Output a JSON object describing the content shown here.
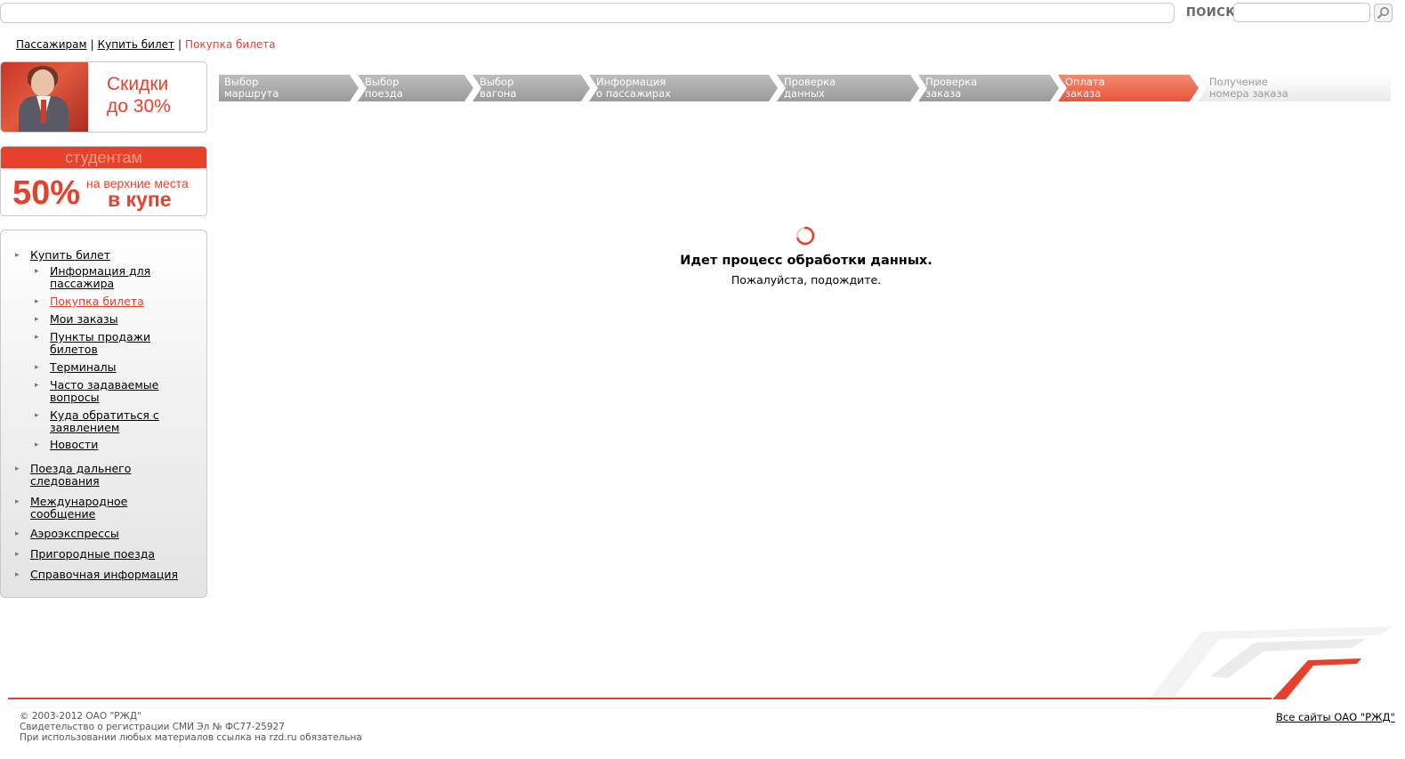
{
  "search": {
    "top_value": "",
    "label": "ПОИСК",
    "value": "",
    "button_icon": "magnifier-icon"
  },
  "breadcrumb": {
    "items": [
      "Пассажирам",
      "Купить билет"
    ],
    "separator": "|",
    "current": "Покупка билета"
  },
  "banners": {
    "discount": {
      "line1": "Скидки",
      "line2": "до 30%"
    },
    "students": {
      "header": "студентам",
      "percent": "50%",
      "line1": "на верхние места",
      "line2": "в купе"
    }
  },
  "sidemenu": {
    "top1": "Купить билет",
    "sub": [
      "Информация для пассажира",
      "Покупка билета",
      "Мои заказы",
      "Пункты продажи билетов",
      "Терминалы",
      "Часто задаваемые вопросы",
      "Куда обратиться с заявлением",
      "Новости"
    ],
    "top": [
      "Поезда дальнего следования",
      "Международное сообщение",
      "Аэроэкспрессы",
      "Пригородные поезда",
      "Справочная информация"
    ]
  },
  "steps": [
    {
      "l1": "Выбор",
      "l2": "маршрута",
      "state": "done"
    },
    {
      "l1": "Выбор",
      "l2": "поезда",
      "state": "done"
    },
    {
      "l1": "Выбор",
      "l2": "вагона",
      "state": "done"
    },
    {
      "l1": "Информация",
      "l2": "о пассажирах",
      "state": "done"
    },
    {
      "l1": "Проверка",
      "l2": "данных",
      "state": "done"
    },
    {
      "l1": "Проверка",
      "l2": "заказа",
      "state": "done"
    },
    {
      "l1": "Оплата",
      "l2": "заказа",
      "state": "current"
    },
    {
      "l1": "Получение",
      "l2": "номера заказа",
      "state": "pending"
    }
  ],
  "loading": {
    "title": "Идет процесс обработки данных.",
    "subtitle": "Пожалуйста, подождите."
  },
  "footer": {
    "line1": "© 2003-2012 ОАО \"РЖД\"",
    "line2": "Свидетельство о регистрации СМИ Эл № ФС77-25927",
    "line3": "При использовании любых материалов ссылка на rzd.ru обязательна",
    "all_sites": "Все сайты ОАО \"РЖД\""
  },
  "colors": {
    "accent": "#e8412b",
    "step_done": "#a8a8a8",
    "step_current": "#ec6a4e"
  }
}
